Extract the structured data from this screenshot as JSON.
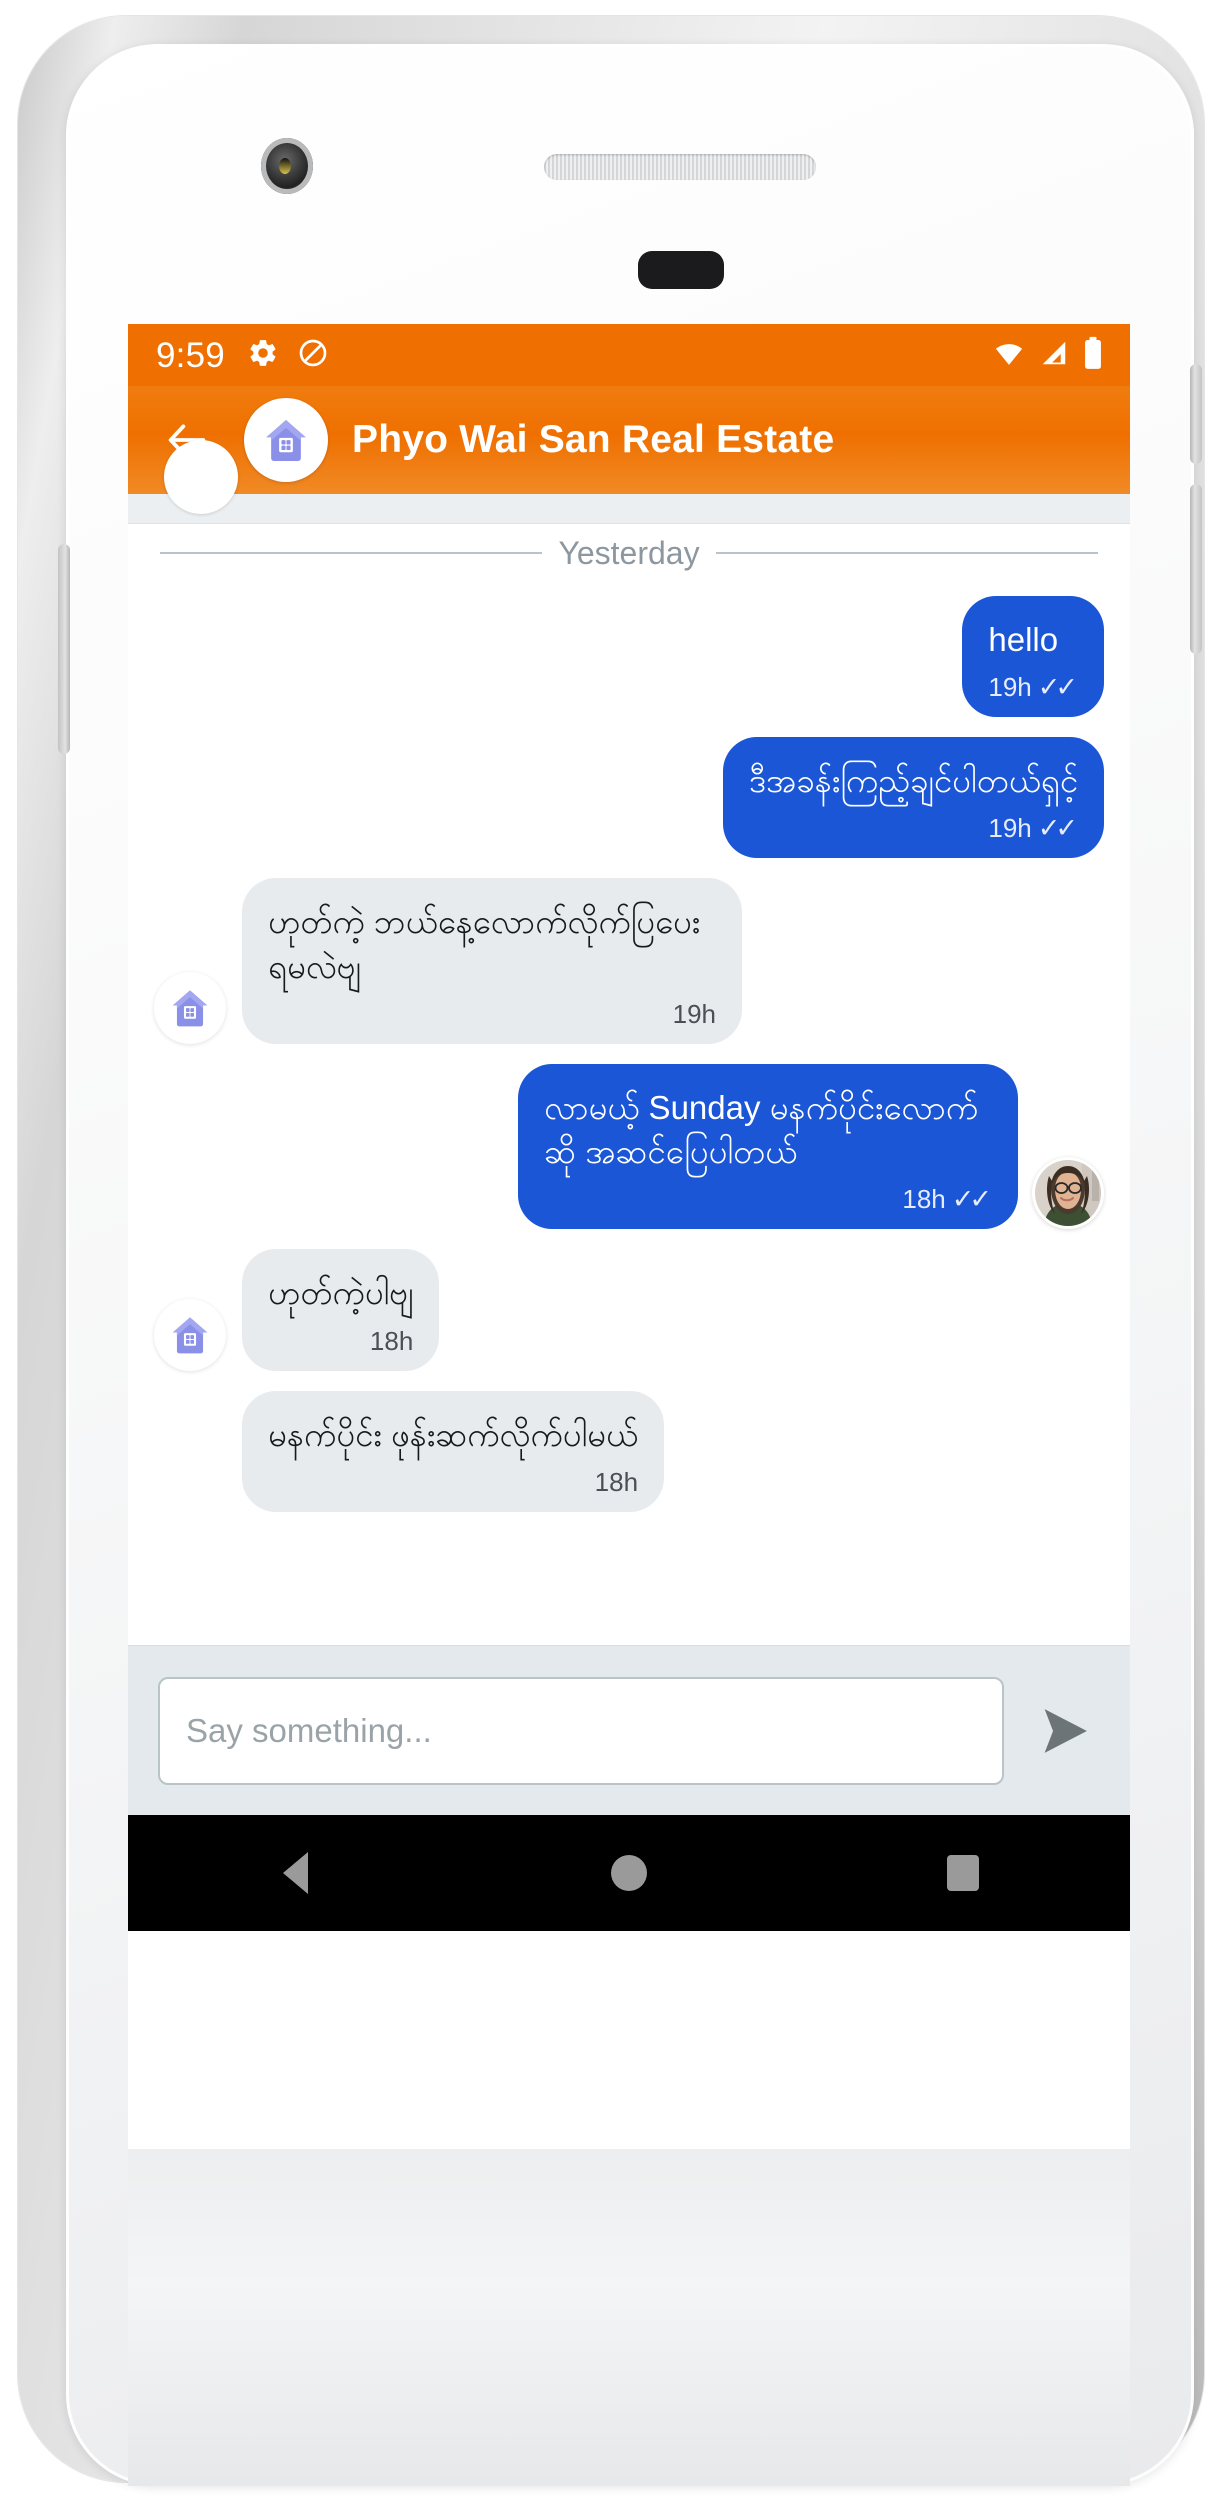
{
  "device": {
    "kind": "white-android-phone-mockup",
    "hardware": {
      "front_camera": "camera-icon",
      "earpiece": "speaker-grille",
      "proximity_sensor": "sensor-dot"
    }
  },
  "statusbar": {
    "time": "9:59",
    "left_icons": [
      "gear-icon",
      "do-not-disturb-icon"
    ],
    "right_icons": [
      "wifi-icon",
      "cellular-signal-icon",
      "battery-full-icon"
    ],
    "background": "#ef7000",
    "foreground": "#ffffff"
  },
  "appbar": {
    "back_label": "Back",
    "back_icon": "arrow-left-icon",
    "avatar_icon": "house-icon",
    "title": "Phyo Wai San Real Estate",
    "background": "#ef7000"
  },
  "chat": {
    "day_divider": "Yesterday",
    "messages": [
      {
        "id": "m1",
        "direction": "out",
        "text": "hello",
        "time": "19h",
        "ticks": "✓✓",
        "avatar": "none"
      },
      {
        "id": "m2",
        "direction": "out",
        "text": "ဒီအခန်းကြည့်ချင်ပါတယ်ရှင့်",
        "time": "19h",
        "ticks": "✓✓",
        "avatar": "none"
      },
      {
        "id": "m3",
        "direction": "in",
        "text": "ဟုတ်ကဲ့ ဘယ်နေ့လောက်လိုက်ပြပေးရမလဲဗျ",
        "time": "19h",
        "ticks": "",
        "avatar": "house-icon"
      },
      {
        "id": "m4",
        "direction": "out",
        "text": "လာမယ့် Sunday မနက်ပိုင်းလောက်ဆို အဆင်ပြေပါတယ်",
        "time": "18h",
        "ticks": "✓✓",
        "avatar": "user-photo"
      },
      {
        "id": "m5",
        "direction": "in",
        "text": "ဟုတ်ကဲ့ပါဗျ",
        "time": "18h",
        "ticks": "",
        "avatar": "house-icon"
      },
      {
        "id": "m6",
        "direction": "in",
        "text": "မနက်ပိုင်း ဖုန်းဆက်လိုက်ပါမယ်",
        "time": "18h",
        "ticks": "",
        "avatar": "none"
      }
    ],
    "bubble_out_color": "#1a56d6",
    "bubble_in_color": "#e8ebee"
  },
  "composer": {
    "placeholder": "Say something...",
    "value": "",
    "send_icon": "send-arrow-icon"
  },
  "navbar": {
    "items": [
      {
        "name": "back",
        "icon": "triangle-back-icon"
      },
      {
        "name": "home",
        "icon": "circle-home-icon"
      },
      {
        "name": "recents",
        "icon": "square-recents-icon"
      }
    ]
  }
}
